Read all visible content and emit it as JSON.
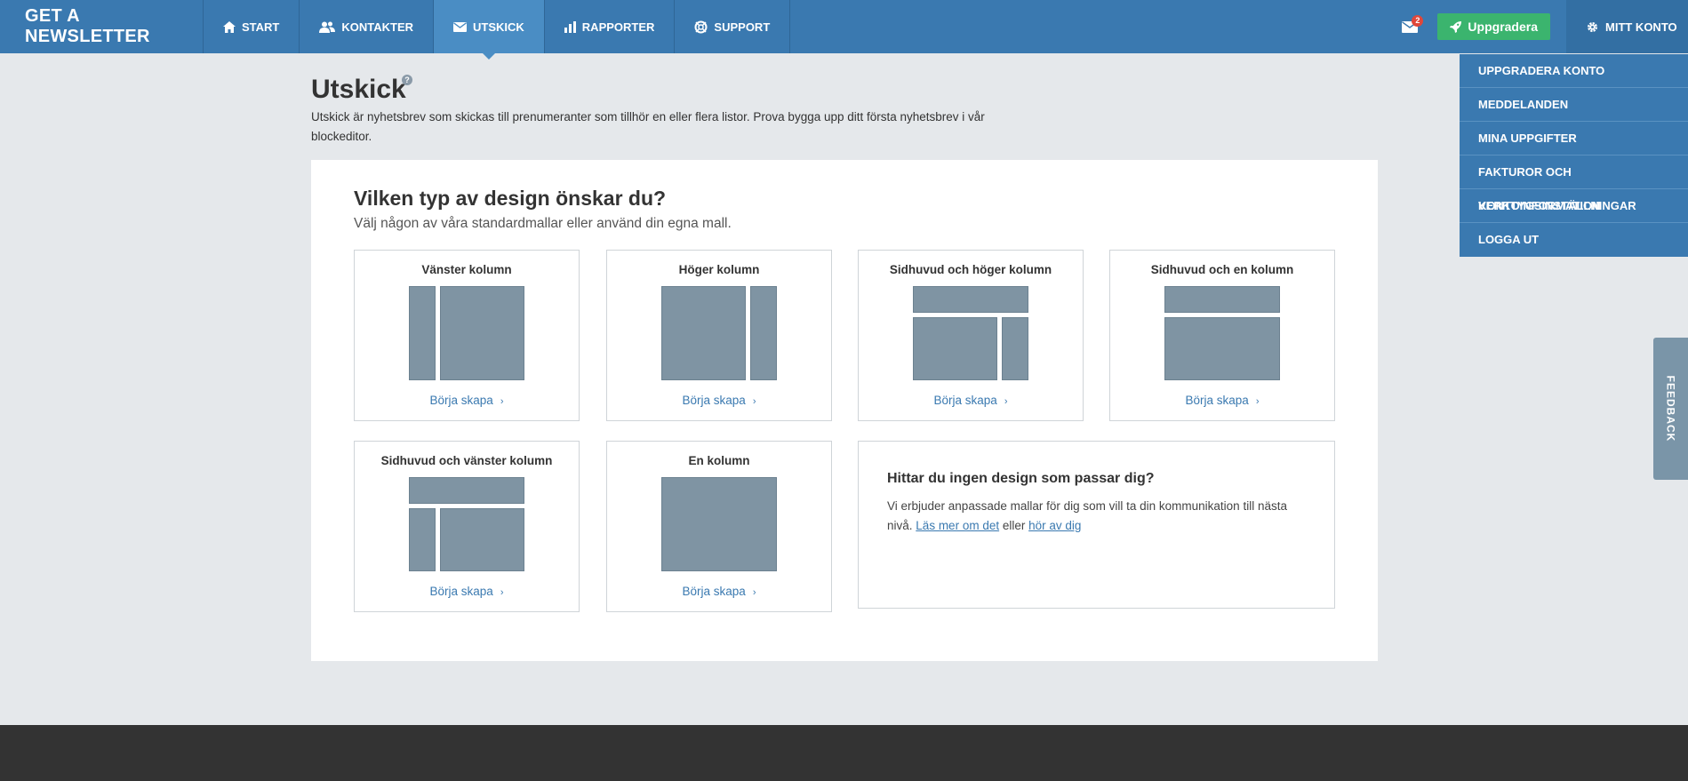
{
  "brand": "GET A NEWSLETTER",
  "nav": [
    {
      "label": "START"
    },
    {
      "label": "KONTAKTER"
    },
    {
      "label": "UTSKICK"
    },
    {
      "label": "RAPPORTER"
    },
    {
      "label": "SUPPORT"
    }
  ],
  "header_right": {
    "mail_badge": "2",
    "upgrade_label": "Uppgradera",
    "account_label": "MITT KONTO"
  },
  "account_menu": [
    "UPPGRADERA KONTO",
    "MEDDELANDEN",
    "MINA UPPGIFTER",
    "FAKTUROR OCH KONTOINFORMATION",
    "VERKTYGSINSTÄLLNINGAR",
    "LOGGA UT"
  ],
  "feedback_label": "FEEDBACK",
  "page": {
    "title": "Utskick",
    "help_glyph": "?",
    "description": "Utskick är nyhetsbrev som skickas till prenumeranter som tillhör en eller flera listor. Prova bygga upp ditt första nyhetsbrev i vår blockeditor."
  },
  "panel": {
    "title": "Vilken typ av design önskar du?",
    "subtitle": "Välj någon av våra standardmallar eller använd din egna mall.",
    "cta_label": "Börja skapa",
    "templates": [
      {
        "title": "Vänster kolumn"
      },
      {
        "title": "Höger kolumn"
      },
      {
        "title": "Sidhuvud och höger kolumn"
      },
      {
        "title": "Sidhuvud och en kolumn"
      },
      {
        "title": "Sidhuvud och vänster kolumn"
      },
      {
        "title": "En kolumn"
      }
    ],
    "info": {
      "title": "Hittar du ingen design som passar dig?",
      "text_before": "Vi erbjuder anpassade mallar för dig som vill ta din kommunikation till nästa nivå.",
      "link1": "Läs mer om det",
      "middle": "eller",
      "link2": "hör av dig"
    }
  }
}
